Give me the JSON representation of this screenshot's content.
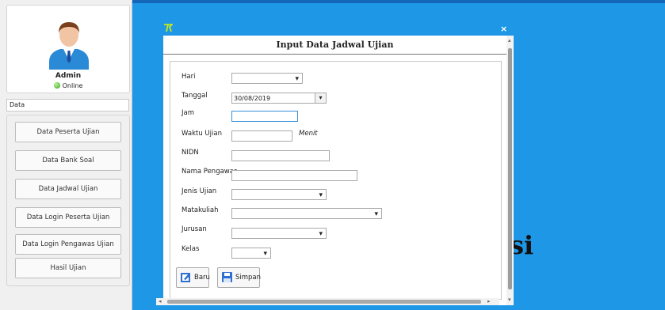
{
  "user": {
    "name": "Admin",
    "status": "Online"
  },
  "sidebar": {
    "section_label": "Data",
    "items": [
      {
        "label": "Data Peserta Ujian"
      },
      {
        "label": "Data Bank Soal"
      },
      {
        "label": "Data Jadwal Ujian"
      },
      {
        "label": "Data Login Peserta Ujian"
      },
      {
        "label": "Data Login Pengawas Ujian"
      },
      {
        "label": "Hasil Ujian"
      }
    ]
  },
  "background_text": "si",
  "dialog": {
    "title": "Input Data Jadwal Ujian",
    "close_glyph": "×",
    "fields": {
      "hari": {
        "label": "Hari",
        "value": ""
      },
      "tanggal": {
        "label": "Tanggal",
        "value": "30/08/2019"
      },
      "jam": {
        "label": "Jam",
        "value": ""
      },
      "waktu": {
        "label": "Waktu Ujian",
        "value": "",
        "unit": "Menit"
      },
      "nidn": {
        "label": "NIDN",
        "value": ""
      },
      "nama_pengawas": {
        "label": "Nama Pengawas",
        "value": ""
      },
      "jenis_ujian": {
        "label": "Jenis Ujian",
        "value": ""
      },
      "matakuliah": {
        "label": "Matakuliah",
        "value": ""
      },
      "jurusan": {
        "label": "Jurusan",
        "value": ""
      },
      "kelas": {
        "label": "Kelas",
        "value": ""
      }
    },
    "buttons": {
      "baru": "Baru",
      "simpan": "Simpan"
    }
  },
  "colors": {
    "desktop_bg": "#1e98e6",
    "accent": "#2f6fd0"
  },
  "icons": [
    "user-avatar-icon",
    "online-status-icon",
    "close-icon",
    "app-logo-icon",
    "new-icon",
    "save-icon"
  ]
}
